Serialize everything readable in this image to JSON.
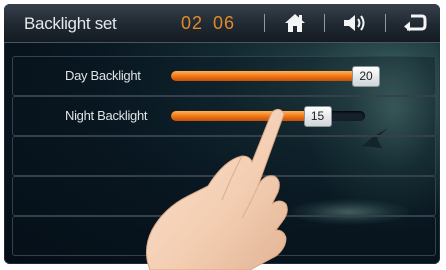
{
  "header": {
    "title": "Backlight set",
    "time_hours": "02",
    "time_minutes": "06",
    "icons": [
      "home-icon",
      "volume-icon",
      "back-icon"
    ],
    "accent_color": "#e08a2a"
  },
  "settings": [
    {
      "label": "Day Backlight",
      "value": "20",
      "level_fraction": 1.0
    },
    {
      "label": "Night Backlight",
      "value": "15",
      "level_fraction": 0.75
    }
  ],
  "slider_color": "#f07a17"
}
